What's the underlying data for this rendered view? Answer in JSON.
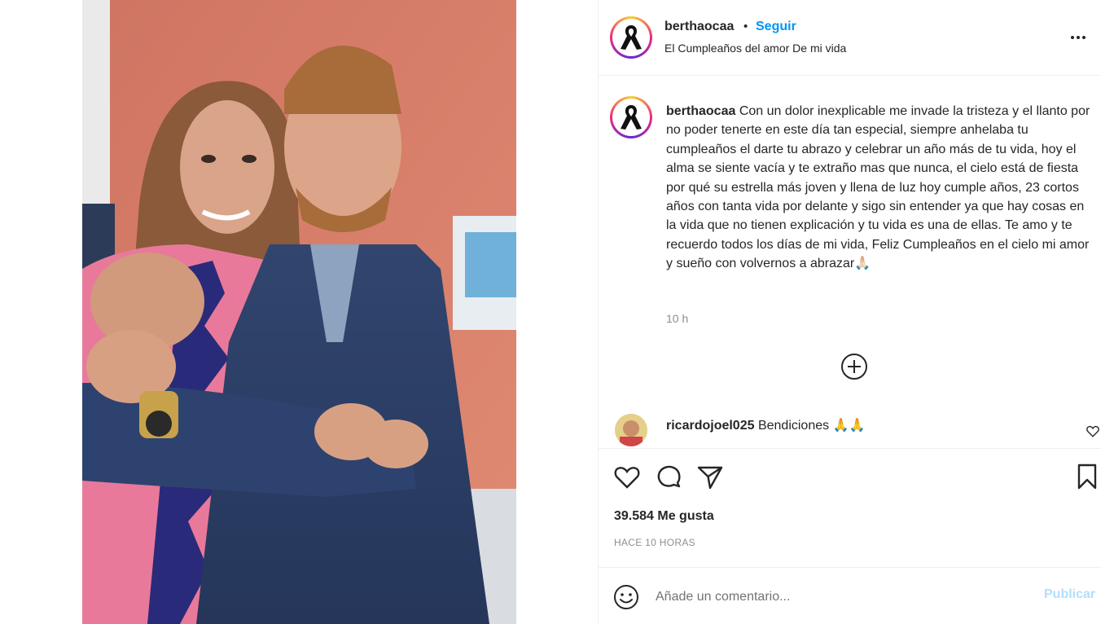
{
  "post": {
    "username": "berthaocaa",
    "follow_label": "Seguir",
    "separator": "•",
    "subtitle": "El Cumpleaños del amor De mi vida",
    "caption": "Con un dolor inexplicable me invade la tristeza y el llanto por no poder tenerte en este día tan especial, siempre anhelaba tu cumpleaños el darte tu abrazo y celebrar un año más de tu vida, hoy el alma se siente vacía y te extraño mas que nunca, el cielo está de fiesta por qué su estrella más joven y llena de luz hoy cumple años, 23 cortos años con tanta vida por delante y sigo sin entender ya que hay cosas en la vida que no tienen explicación y tu vida es una de ellas. Te amo y te recuerdo todos los días de mi vida, Feliz Cumpleaños en el cielo mi amor y sueño con volvernos a abrazar🙏🏻",
    "caption_time": "10 h",
    "likes": "39.584 Me gusta",
    "posted_ago": "HACE 10 HORAS"
  },
  "comments": [
    {
      "username": "ricardojoel025",
      "text": "Bendiciones 🙏🙏"
    }
  ],
  "comment_bar": {
    "placeholder": "Añade un comentario...",
    "publish_label": "Publicar"
  },
  "icons": {
    "more": "more-options-icon",
    "load_more": "add-circle-icon",
    "like": "heart-icon",
    "comment": "comment-icon",
    "share": "paper-plane-icon",
    "save": "bookmark-icon",
    "emoji": "emoji-icon",
    "avatar": "black-ribbon-icon"
  },
  "colors": {
    "accent": "#0095f6",
    "publish_disabled": "#b2dffc",
    "muted": "#8e8e8e"
  }
}
